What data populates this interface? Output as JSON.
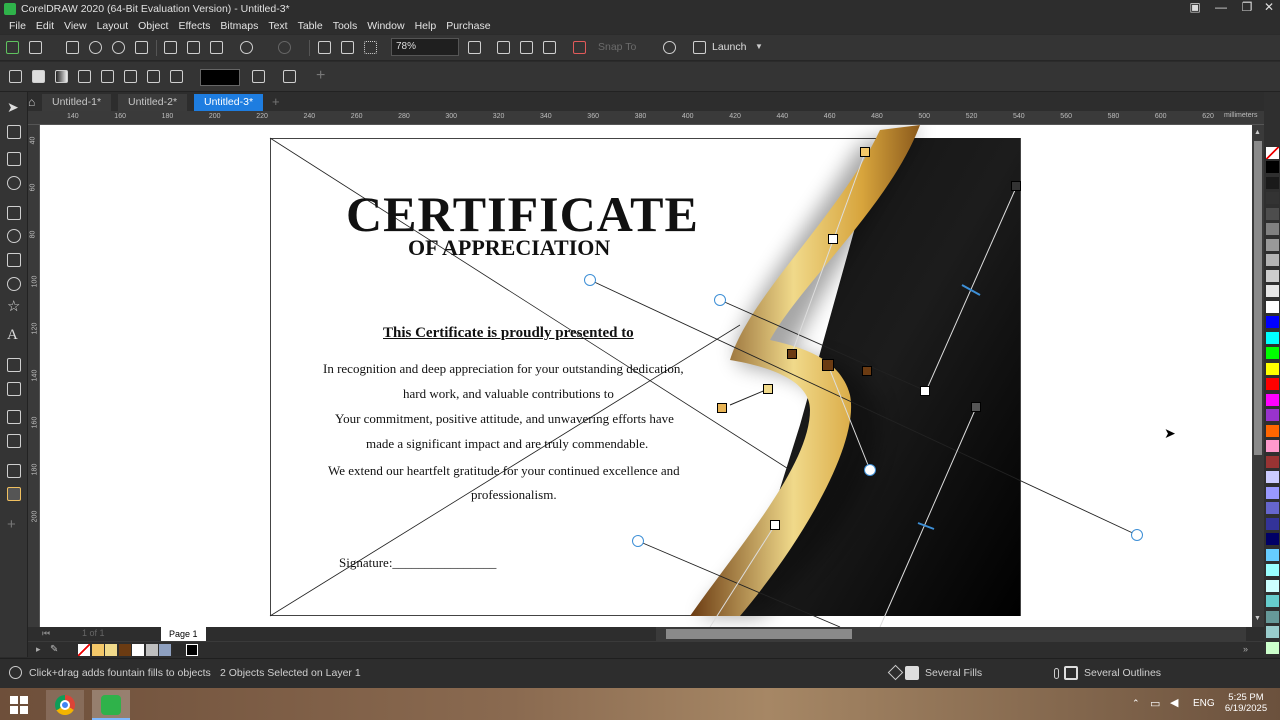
{
  "app": {
    "title": "CorelDRAW 2020 (64-Bit Evaluation Version) - Untitled-3*",
    "accent": "#1e7de0"
  },
  "menu": [
    "File",
    "Edit",
    "View",
    "Layout",
    "Object",
    "Effects",
    "Bitmaps",
    "Text",
    "Table",
    "Tools",
    "Window",
    "Help",
    "Purchase"
  ],
  "toolbar": {
    "zoom": "78%",
    "snap_to": "Snap To",
    "launch": "Launch"
  },
  "tabs": [
    {
      "label": "Untitled-1*",
      "active": false
    },
    {
      "label": "Untitled-2*",
      "active": false
    },
    {
      "label": "Untitled-3*",
      "active": true
    }
  ],
  "ruler": {
    "top_ticks": [
      "140",
      "160",
      "180",
      "200",
      "220",
      "240",
      "260",
      "280",
      "300",
      "320",
      "340",
      "360",
      "380",
      "400",
      "420",
      "440",
      "460",
      "480",
      "500",
      "520",
      "540",
      "560",
      "580",
      "600",
      "620"
    ],
    "unit": "millimeters",
    "left_ticks": [
      "40",
      "60",
      "80",
      "100",
      "120",
      "140",
      "160",
      "180",
      "200"
    ]
  },
  "certificate": {
    "title": "CERTIFICATE",
    "subtitle": "OF APPRECIATION",
    "presented": "This Certificate is proudly presented to",
    "body_lines": [
      "In recognition and deep appreciation for your outstanding dedication,",
      "hard work, and valuable contributions to",
      "Your commitment, positive attitude, and unwavering efforts have",
      "made a significant impact and are truly commendable.",
      "We extend our heartfelt gratitude for your continued excellence and",
      "professionalism."
    ],
    "signature": "Signature:________________"
  },
  "pagebar": {
    "page_count": "1 of 1",
    "page_tab": "Page 1"
  },
  "status": {
    "hint": "Click+drag adds fountain fills to objects",
    "selection": "2 Objects Selected on Layer 1",
    "fill": "Several Fills",
    "outline": "Several Outlines"
  },
  "taskbar": {
    "lang": "ENG",
    "time": "5:25 PM",
    "date": "6/19/2025"
  },
  "palette_colors": [
    "#000000",
    "#1a1a1a",
    "#333333",
    "#4d4d4d",
    "#808080",
    "#999999",
    "#b3b3b3",
    "#cccccc",
    "#e6e6e6",
    "#ffffff",
    "#0000ff",
    "#00ffff",
    "#00ff00",
    "#ffff00",
    "#ff0000",
    "#ff00ff",
    "#9933cc",
    "#ff6600",
    "#ff99cc",
    "#993333",
    "#ccccff",
    "#9999ff",
    "#6666cc",
    "#333399",
    "#000066",
    "#66ccff",
    "#99ffff",
    "#ccffff",
    "#66cccc",
    "#669999",
    "#99cccc",
    "#ccffcc"
  ],
  "doc_colors": [
    "#ffffff",
    "#f4c869",
    "#f0d98a",
    "#6b3b12",
    "#ffffff",
    "#bfbfbf",
    "#8ea0c0",
    "#2a2a2a",
    "#000000"
  ]
}
